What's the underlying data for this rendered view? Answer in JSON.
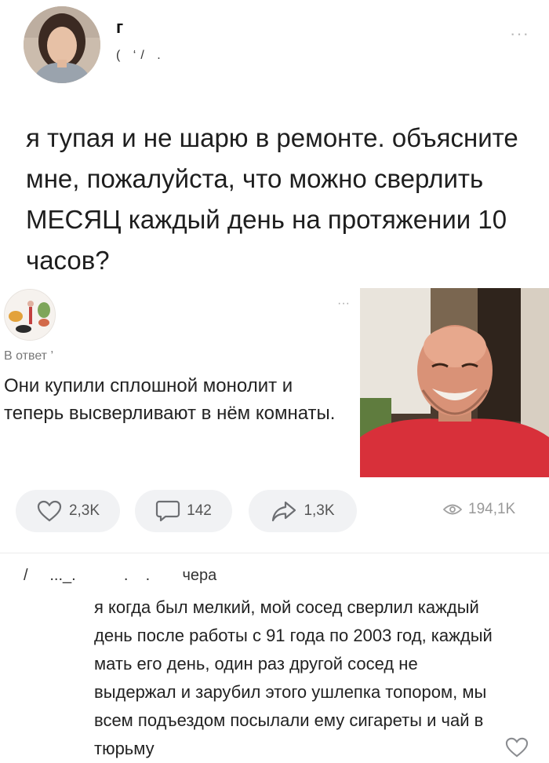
{
  "post": {
    "author_name": "г",
    "author_meta": "( ‘/  .",
    "more_glyph": "···",
    "text": "я тупая и не шарю в ремонте. объясните мне, пожалуйста, что можно сверлить МЕСЯЦ каждый день на протяжении 10 часов?"
  },
  "reply": {
    "more_glyph": "···",
    "meta": "В ответ ’",
    "text": "Они купили сплошной монолит и теперь высверливают в нём комнаты."
  },
  "actions": {
    "likes": "2,3K",
    "comments": "142",
    "shares": "1,3K",
    "views": "194,1K"
  },
  "comment": {
    "meta": "/     ..._.           .    .        чера",
    "text": "я когда был мелкий, мой сосед сверлил каждый день после работы с 91 года по 2003 год, каждый мать его день, один раз другой сосед не выдержал и зарубил этого ушлепка топором, мы всем подъездом посылали ему сигареты и чай в тюрьму"
  },
  "colors": {
    "pill_bg": "#f1f2f4",
    "icon_gray": "#6d6f73",
    "muted_text": "#999999"
  }
}
